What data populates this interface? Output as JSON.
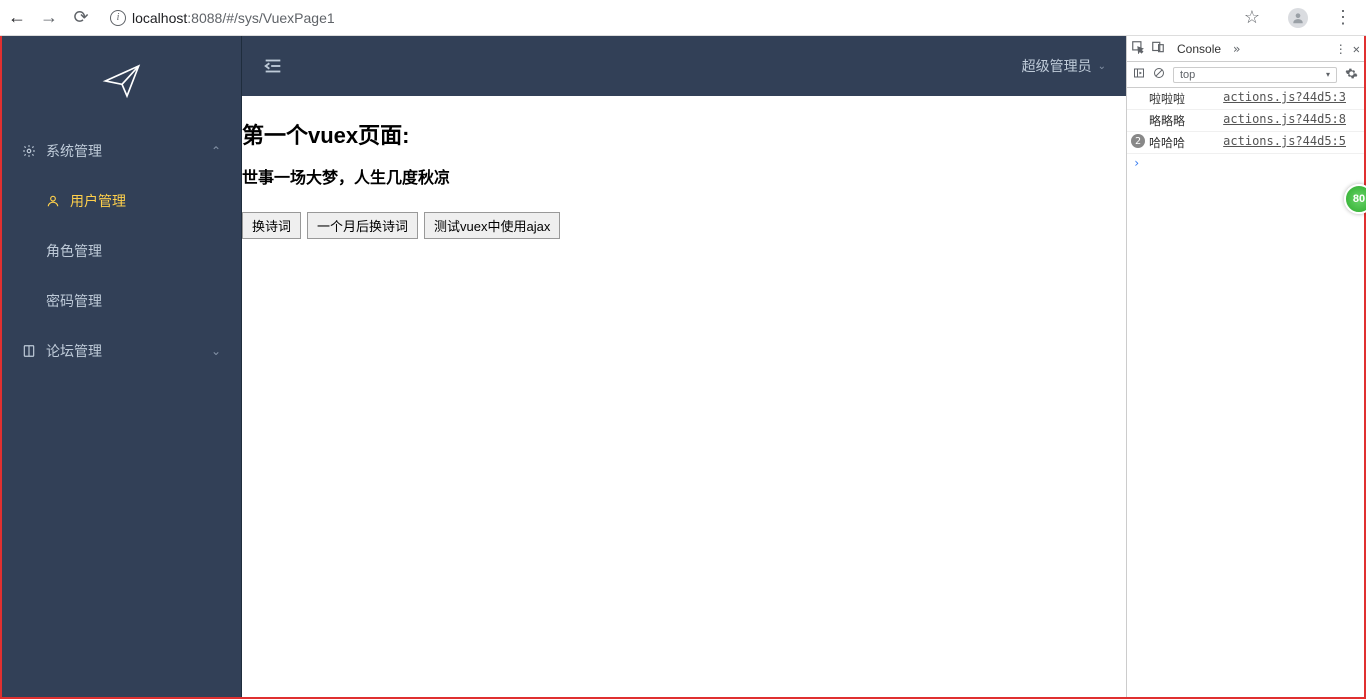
{
  "browser": {
    "url_host": "localhost",
    "url_port": ":8088",
    "url_path": "/#/sys/VuexPage1"
  },
  "sidebar": {
    "groups": [
      {
        "label": "系统管理",
        "expanded": true,
        "items": [
          {
            "label": "用户管理",
            "active": true
          },
          {
            "label": "角色管理",
            "active": false
          },
          {
            "label": "密码管理",
            "active": false
          }
        ]
      },
      {
        "label": "论坛管理",
        "expanded": false,
        "items": []
      }
    ]
  },
  "header": {
    "user_label": "超级管理员"
  },
  "content": {
    "title": "第一个vuex页面:",
    "subtitle": "世事一场大梦，人生几度秋凉",
    "buttons": [
      "换诗词",
      "一个月后换诗词",
      "测试vuex中使用ajax"
    ]
  },
  "devtools": {
    "active_tab": "Console",
    "context": "top",
    "logs": [
      {
        "badge": "",
        "msg": "啦啦啦",
        "src": "actions.js?44d5:3"
      },
      {
        "badge": "",
        "msg": "略略略",
        "src": "actions.js?44d5:8"
      },
      {
        "badge": "2",
        "msg": "哈哈哈",
        "src": "actions.js?44d5:5"
      }
    ]
  },
  "floating_badge": "80"
}
